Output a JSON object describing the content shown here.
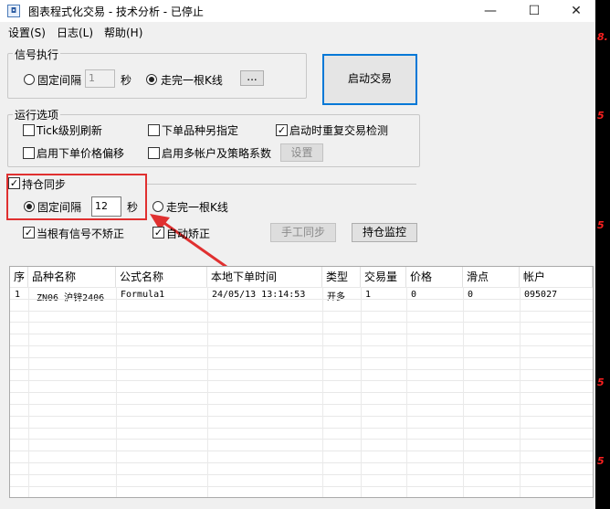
{
  "window": {
    "title": "图表程式化交易 - 技术分析 - 已停止",
    "minimize": "—",
    "maximize": "☐",
    "close": "✕"
  },
  "menu": [
    "设置(S)",
    "日志(L)",
    "帮助(H)"
  ],
  "signal": {
    "group_label": "信号执行",
    "fixed_label": "固定间隔",
    "interval_value": "1",
    "unit": "秒",
    "kline_label": "走完一根K线",
    "more_button": "..."
  },
  "start_button": "启动交易",
  "options": {
    "group_label": "运行选项",
    "tick_refresh": "Tick级别刷新",
    "other_variety": "下单品种另指定",
    "restart_check": "启动时重复交易检测",
    "price_offset": "启用下单价格偏移",
    "multi_account": "启用多帐户及策略系数",
    "settings_button": "设置"
  },
  "position_sync": {
    "label": "持仓同步",
    "fixed_label": "固定间隔",
    "interval_value": "12",
    "unit": "秒",
    "kline_label": "走完一根K线",
    "no_correct": "当根有信号不矫正",
    "auto_correct": "自动矫正",
    "manual_sync": "手工同步",
    "monitor": "持仓监控"
  },
  "table": {
    "headers": [
      "序",
      "品种名称",
      "公式名称",
      "本地下单时间",
      "类型",
      "交易量",
      "价格",
      "滑点",
      "帐户"
    ],
    "rows": [
      [
        "1",
        "ZN06 沪锌2406",
        "Formula1",
        "24/05/13 13:14:53",
        "开多",
        "1",
        "0",
        "0",
        "095027"
      ]
    ]
  },
  "right_strip": [
    "8.",
    "5",
    "5",
    "5",
    "5"
  ],
  "colors": {
    "highlight": "#e03030",
    "accent": "#0078d7"
  }
}
